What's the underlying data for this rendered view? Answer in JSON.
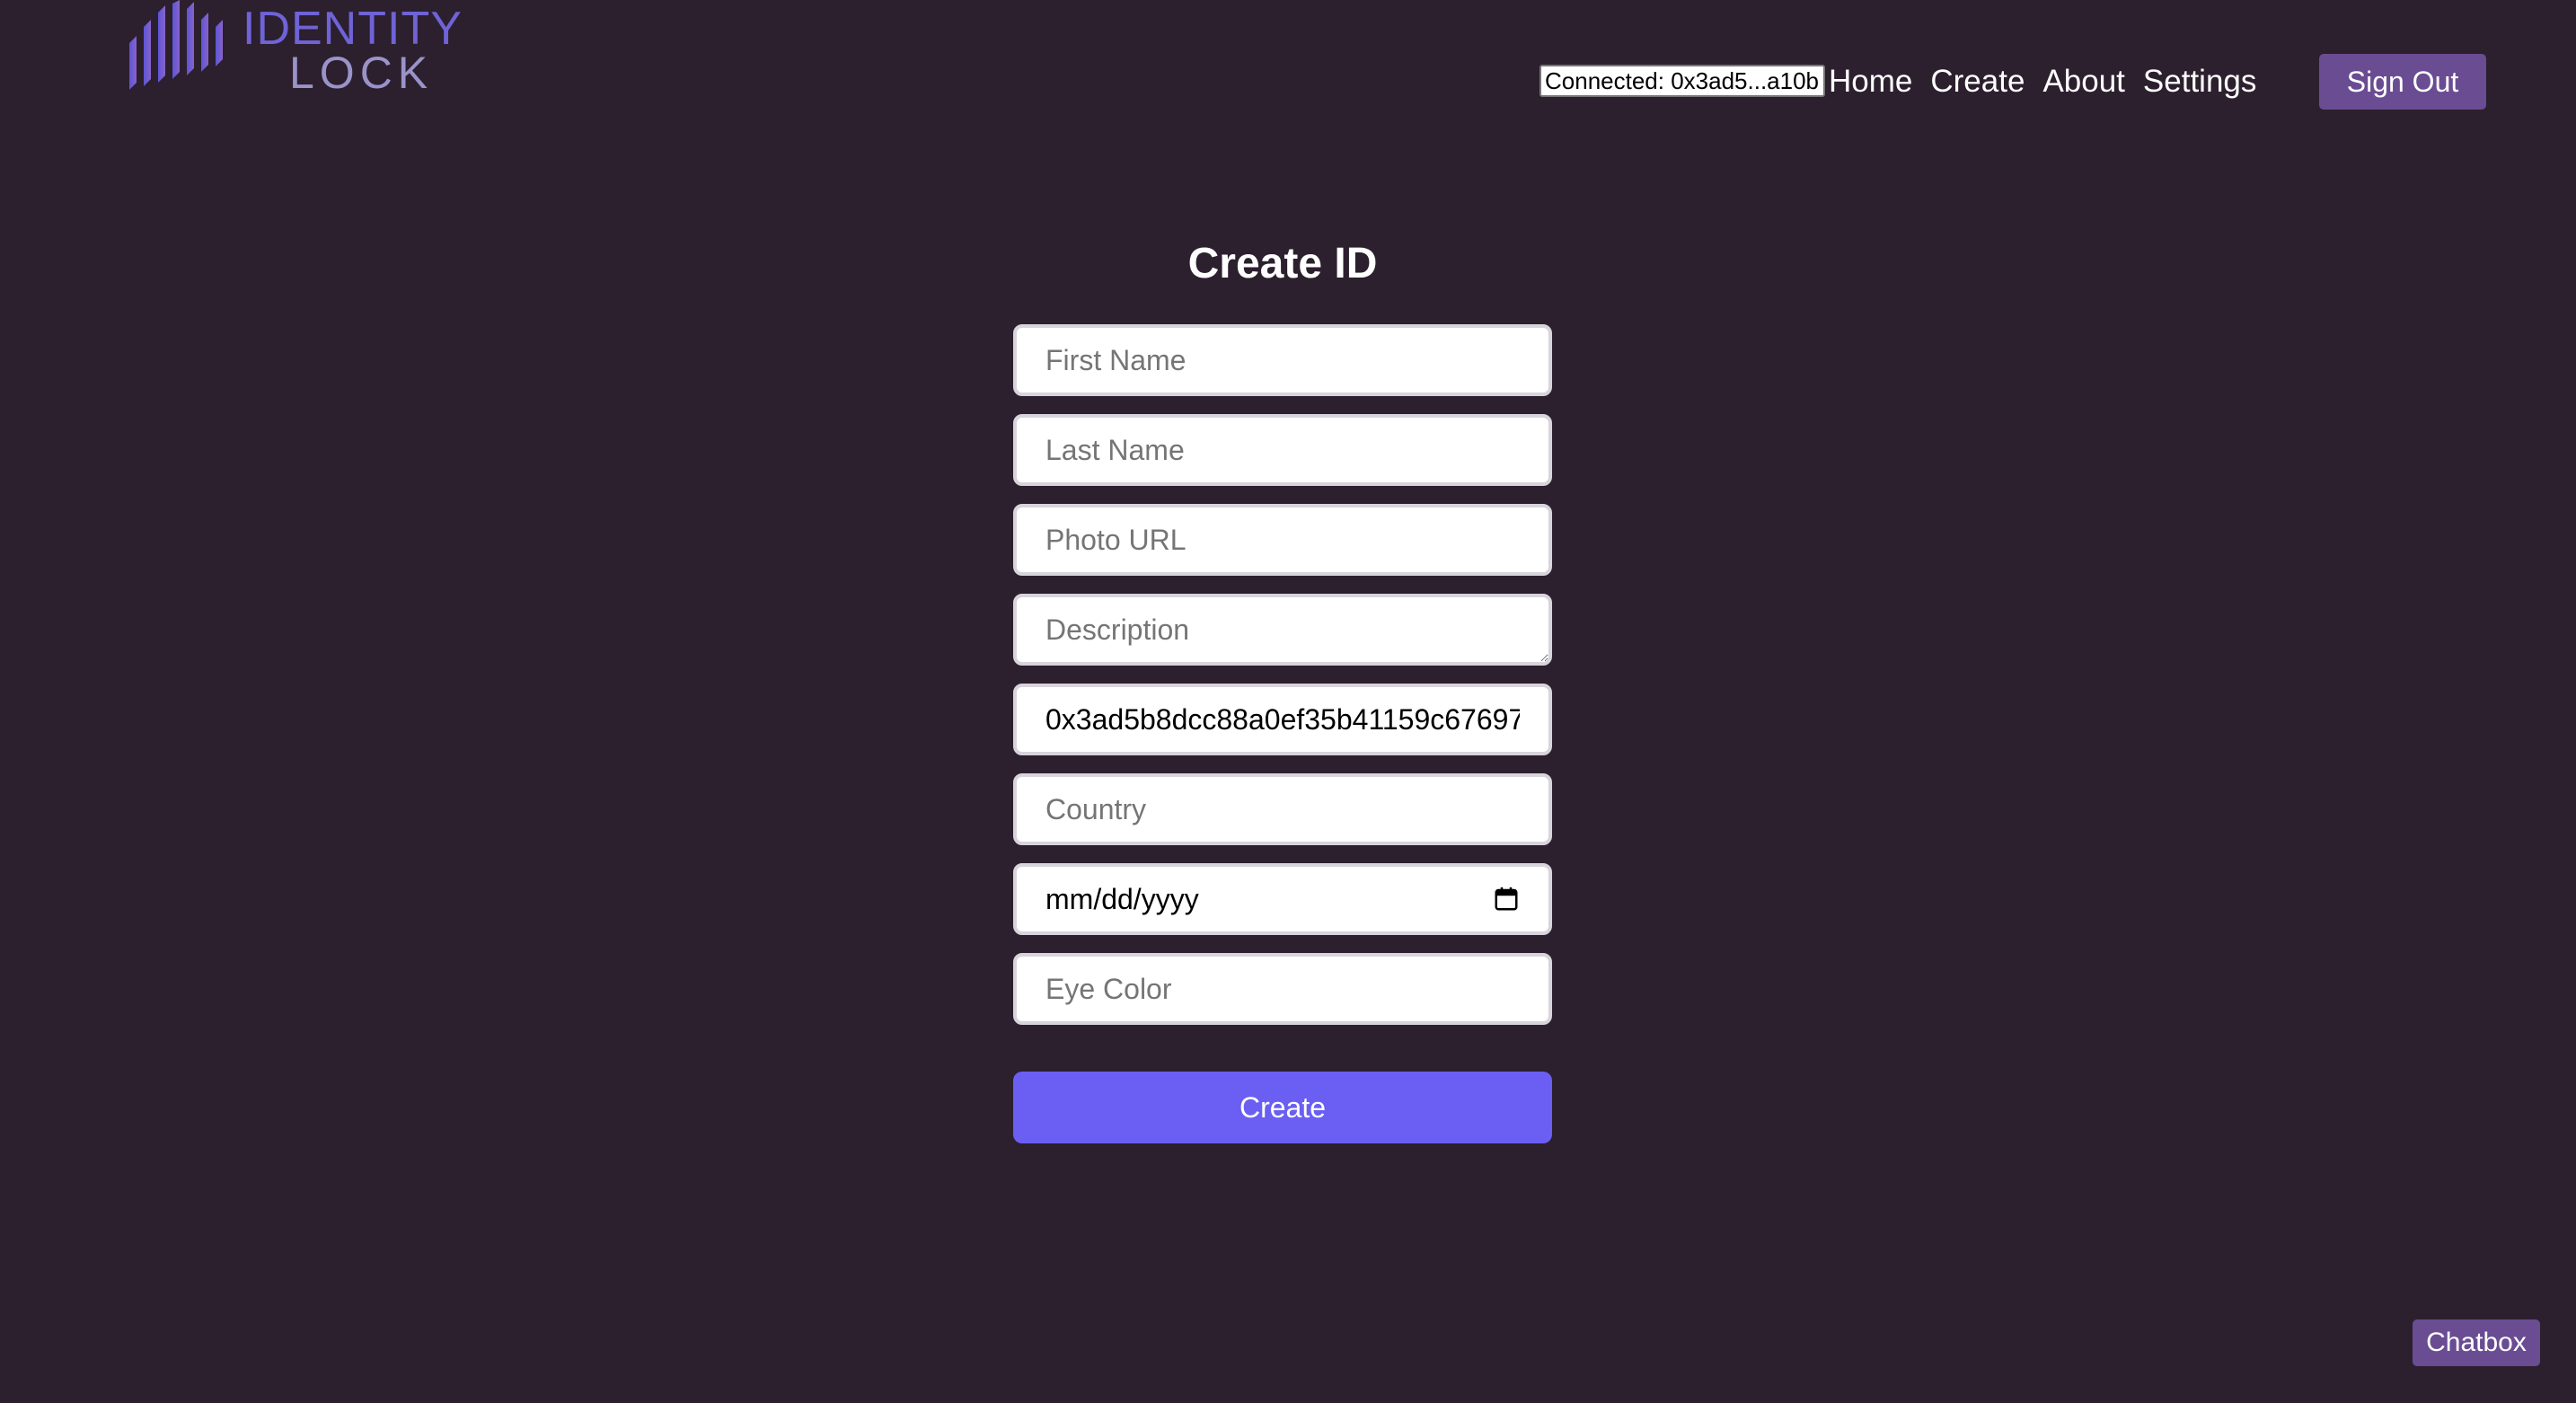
{
  "header": {
    "logo": {
      "line1": "IDENTITY",
      "line2": "LOCK",
      "colors": {
        "bars": "#6f63d6",
        "text": "#6f63d6"
      }
    },
    "connected_label": "Connected: 0x3ad5...a10b",
    "nav": [
      {
        "label": "Home"
      },
      {
        "label": "Create"
      },
      {
        "label": "About"
      },
      {
        "label": "Settings"
      }
    ],
    "sign_out_label": "Sign Out"
  },
  "form": {
    "title": "Create ID",
    "fields": {
      "first_name": {
        "placeholder": "First Name",
        "value": ""
      },
      "last_name": {
        "placeholder": "Last Name",
        "value": ""
      },
      "photo_url": {
        "placeholder": "Photo URL",
        "value": ""
      },
      "description": {
        "placeholder": "Description",
        "value": ""
      },
      "wallet_address": {
        "value": "0x3ad5b8dcc88a0ef35b41159c67697"
      },
      "country": {
        "placeholder": "Country",
        "value": ""
      },
      "birth_date": {
        "display": "mm/dd/yyyy",
        "icon": "calendar-icon"
      },
      "eye_color": {
        "placeholder": "Eye Color",
        "value": ""
      }
    },
    "submit_label": "Create"
  },
  "chatbox_label": "Chatbox",
  "colors": {
    "background": "#2c1f2e",
    "accent": "#6a4c93",
    "primary_button": "#6a5ff2"
  }
}
